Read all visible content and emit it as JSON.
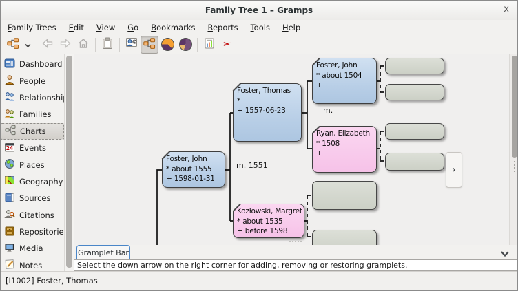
{
  "window": {
    "title": "Family Tree 1 – Gramps",
    "close_glyph": "x"
  },
  "menu": {
    "items": [
      {
        "label": "Family Trees"
      },
      {
        "label": "Edit"
      },
      {
        "label": "View"
      },
      {
        "label": "Go"
      },
      {
        "label": "Bookmarks"
      },
      {
        "label": "Reports"
      },
      {
        "label": "Tools"
      },
      {
        "label": "Help"
      }
    ]
  },
  "toolbar": {
    "buttons": [
      {
        "name": "family-trees-button",
        "icon": "gramps-tree-icon"
      },
      {
        "name": "family-trees-dropdown",
        "icon": "chevron-down-icon"
      },
      {
        "name": "back-button",
        "icon": "arrow-left-icon",
        "enabled": false
      },
      {
        "name": "forward-button",
        "icon": "arrow-right-icon",
        "enabled": false
      },
      {
        "name": "home-button",
        "icon": "home-icon",
        "enabled": false
      },
      {
        "name": "clipboard-button",
        "icon": "clipboard-icon"
      },
      {
        "name": "person-chart-view-button",
        "icon": "person-chart-icon"
      },
      {
        "name": "pedigree-view-button",
        "icon": "pedigree-icon",
        "active": true
      },
      {
        "name": "fan-chart-view-button",
        "icon": "fan-chart-icon"
      },
      {
        "name": "descendant-fan-view-button",
        "icon": "fan-chart-alt-icon"
      },
      {
        "name": "reports-button",
        "icon": "report-doc-icon"
      },
      {
        "name": "tools-button",
        "icon": "scissors-tools-icon"
      }
    ]
  },
  "sidebar": {
    "selected": "Charts",
    "items": [
      {
        "label": "Dashboard",
        "icon": "dashboard-icon"
      },
      {
        "label": "People",
        "icon": "person-icon"
      },
      {
        "label": "Relationships",
        "icon": "relationships-icon"
      },
      {
        "label": "Families",
        "icon": "families-icon"
      },
      {
        "label": "Charts",
        "icon": "charts-tree-icon"
      },
      {
        "label": "Events",
        "icon": "calendar-icon"
      },
      {
        "label": "Places",
        "icon": "globe-icon"
      },
      {
        "label": "Geography",
        "icon": "map-icon"
      },
      {
        "label": "Sources",
        "icon": "book-icon"
      },
      {
        "label": "Citations",
        "icon": "citation-search-icon"
      },
      {
        "label": "Repositories",
        "icon": "repository-icon"
      },
      {
        "label": "Media",
        "icon": "media-monitor-icon"
      },
      {
        "label": "Notes",
        "icon": "note-pencil-icon"
      }
    ]
  },
  "chart": {
    "marriage_center": "m. 1551",
    "marriage_grandparents": "m.",
    "nav_arrow": "›",
    "persons": {
      "active": {
        "name": "Foster, John",
        "birth": "* about 1555",
        "death": "+ 1598-01-31"
      },
      "father": {
        "name": "Foster, Thomas",
        "birth": "*",
        "death": "+ 1557-06-23"
      },
      "mother": {
        "name": "Kozłowski, Margret",
        "birth": "* about 1535",
        "death": "+ before 1598"
      },
      "paternal_grandfather": {
        "name": "Foster, John",
        "birth": "* about 1504",
        "death": "+"
      },
      "paternal_grandmother": {
        "name": "Ryan, Elizabeth",
        "birth": "* 1508",
        "death": "+"
      }
    }
  },
  "gramplet_bar": {
    "tab_label": "Gramplet Bar",
    "message": "Select the down arrow on the right corner for adding, removing or restoring gramplets."
  },
  "statusbar": {
    "text": "[I1002] Foster, Thomas"
  },
  "colors": {
    "male_box": "#bdd2e8",
    "female_box": "#f8c9ec",
    "empty_box": "#d5d9d0",
    "canvas_bg": "#f0efee",
    "tab_accent": "#4a86c8"
  }
}
